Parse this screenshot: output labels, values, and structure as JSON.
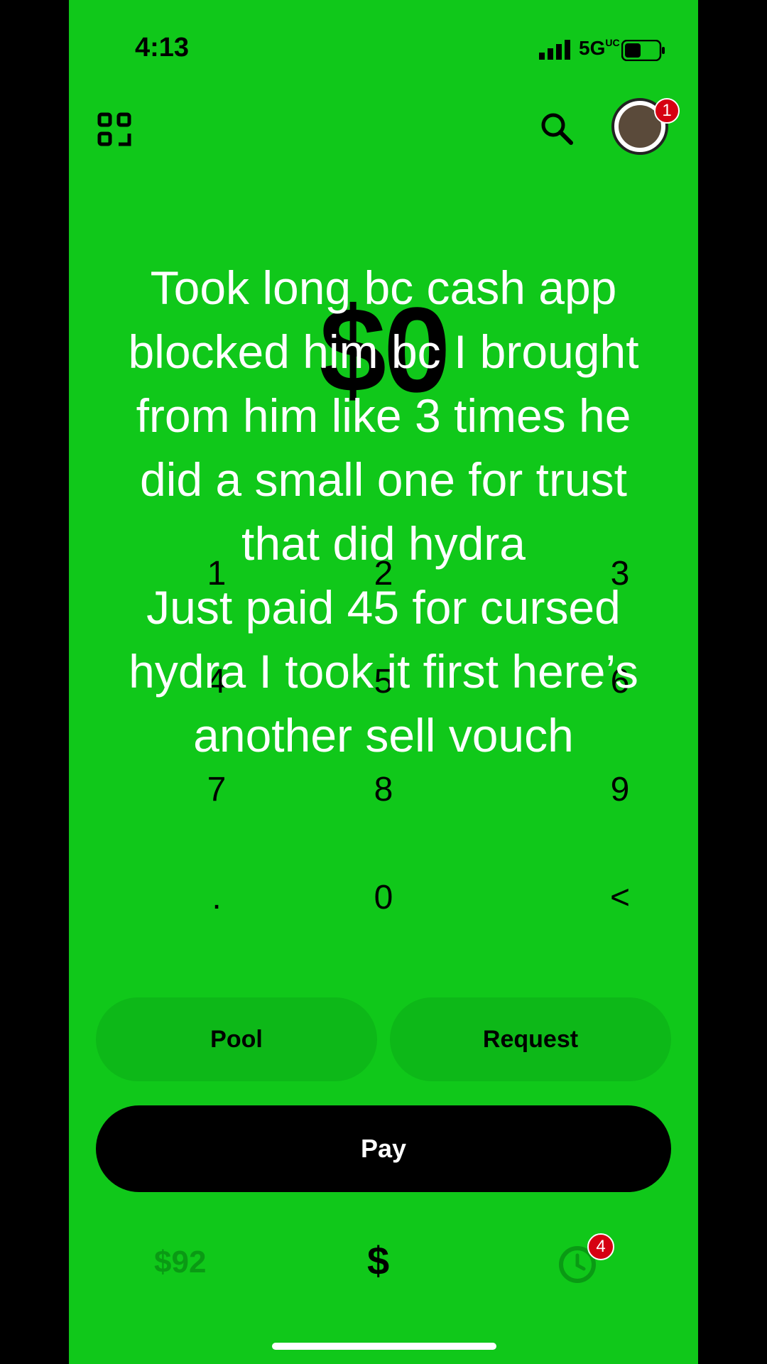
{
  "status": {
    "time": "4:13",
    "network": "5G",
    "network_sub": "UC"
  },
  "amount": "$0",
  "keypad": {
    "keys": [
      "1",
      "2",
      "3",
      "4",
      "5",
      "6",
      "7",
      "8",
      "9",
      ".",
      "0",
      "<"
    ]
  },
  "actions": {
    "pool_label": "Pool",
    "request_label": "Request",
    "pay_label": "Pay"
  },
  "nav": {
    "balance": "$92",
    "dollar": "$",
    "activity_badge": "4"
  },
  "profile_badge": "1",
  "overlay_text": {
    "line1": "Took long bc cash app",
    "line2": "blocked him bc I brought",
    "line3": "from him like 3 times he",
    "line4": "did a small one for trust",
    "line5": "that did hydra",
    "line6": "Just paid 45 for cursed",
    "line7": "hydra I took it first here’s",
    "line8": "another sell vouch"
  },
  "colors": {
    "background": "#10C81A",
    "pill": "#0DB818",
    "badge": "#D60012"
  },
  "icons": [
    "qr-scan-icon",
    "search-icon",
    "clock-icon",
    "signal-icon",
    "battery-icon"
  ]
}
